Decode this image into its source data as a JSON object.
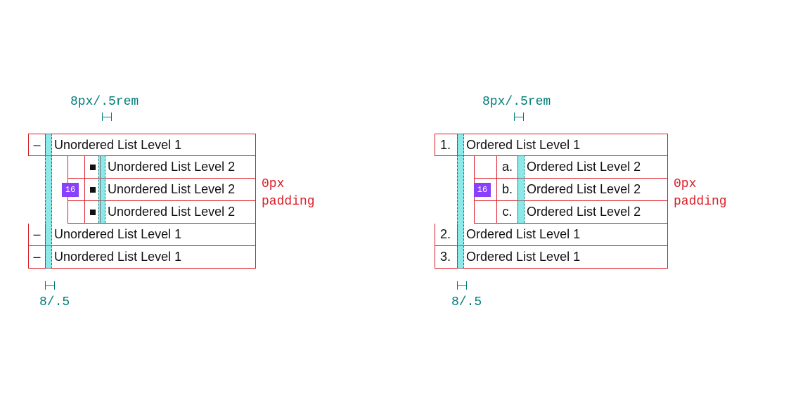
{
  "labels": {
    "top_spacing": "8px/.5rem",
    "bottom_spacing": "8/.5",
    "chip": "16",
    "side_padding": "0px\npadding"
  },
  "ul": {
    "l1": [
      {
        "marker": "–",
        "text": "Unordered List Level 1"
      },
      {
        "marker": "–",
        "text": "Unordered List Level 1"
      },
      {
        "marker": "–",
        "text": "Unordered List Level 1"
      }
    ],
    "l2": [
      {
        "text": "Unordered List Level 2"
      },
      {
        "text": "Unordered List Level 2"
      },
      {
        "text": "Unordered List Level 2"
      }
    ]
  },
  "ol": {
    "l1": [
      {
        "marker": "1.",
        "text": "Ordered List Level 1"
      },
      {
        "marker": "2.",
        "text": "Ordered List Level 1"
      },
      {
        "marker": "3.",
        "text": "Ordered List Level 1"
      }
    ],
    "l2": [
      {
        "marker": "a.",
        "text": "Ordered List Level 2"
      },
      {
        "marker": "b.",
        "text": "Ordered List Level 2"
      },
      {
        "marker": "c.",
        "text": "Ordered List Level 2"
      }
    ]
  }
}
